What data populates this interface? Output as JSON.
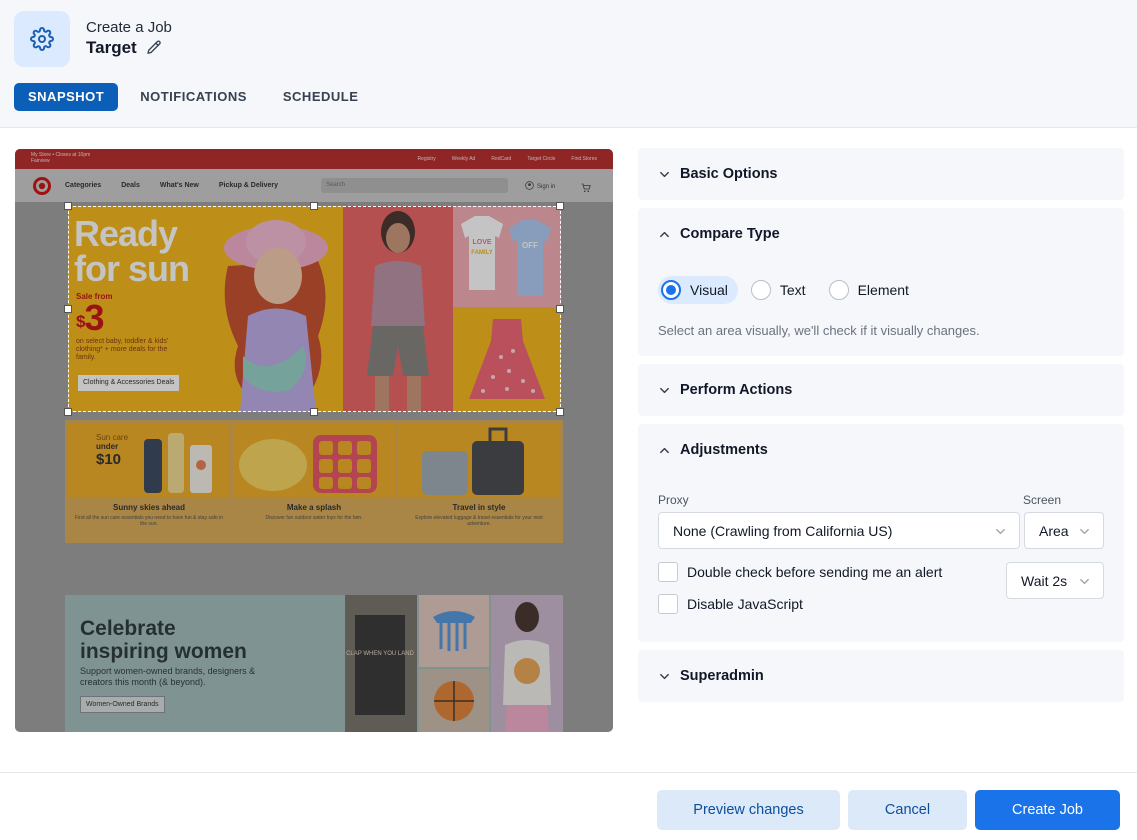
{
  "header": {
    "breadcrumb": "Create a Job",
    "title": "Target",
    "tabs": [
      {
        "label": "SNAPSHOT",
        "active": true
      },
      {
        "label": "NOTIFICATIONS",
        "active": false
      },
      {
        "label": "SCHEDULE",
        "active": false
      }
    ]
  },
  "preview": {
    "topbar": {
      "location": "My Store  •  Closes at 10pm",
      "store": "Fairview",
      "links": [
        "Registry",
        "Weekly Ad",
        "RedCard",
        "Target Circle",
        "Find Stores"
      ]
    },
    "nav": {
      "links": [
        "Categories",
        "Deals",
        "What's New",
        "Pickup & Delivery"
      ],
      "search_placeholder": "Search",
      "signin": "Sign in"
    },
    "hero": {
      "headline_1": "Ready",
      "headline_2": "for sun",
      "sale_from": "Sale from",
      "price": "3",
      "currency": "$",
      "description": "on select baby, toddler & kids' clothing* + more deals for the family.",
      "button": "Clothing & Accessories Deals",
      "onesie_text_1": "LOVE",
      "onesie_text_2": "FAMILY",
      "onesie_text_3": "OFF"
    },
    "cards": [
      {
        "title": "Sunny skies ahead",
        "subtitle": "Find all the sun care essentials you need to have fun & stay safe in the sun.",
        "badge_1": "Sun care",
        "badge_2": "under",
        "badge_3": "$10"
      },
      {
        "title": "Make a splash",
        "subtitle": "Discover fun outdoor water toys for the fam."
      },
      {
        "title": "Travel in style",
        "subtitle": "Explore elevated luggage & travel essentials for your next adventure."
      }
    ],
    "banner2": {
      "title_1": "Celebrate",
      "title_2": "inspiring women",
      "subtitle": "Support women-owned brands, designers & creators this month (& beyond).",
      "button": "Women-Owned Brands",
      "book_text": "CLAP WHEN YOU LAND"
    }
  },
  "sections": {
    "basic_options": {
      "label": "Basic Options",
      "expanded": false
    },
    "compare_type": {
      "label": "Compare Type",
      "expanded": true,
      "options": [
        {
          "label": "Visual",
          "selected": true
        },
        {
          "label": "Text",
          "selected": false
        },
        {
          "label": "Element",
          "selected": false
        }
      ],
      "hint": "Select an area visually, we'll check if it visually changes."
    },
    "perform_actions": {
      "label": "Perform Actions",
      "expanded": false
    },
    "adjustments": {
      "label": "Adjustments",
      "expanded": true,
      "proxy_label": "Proxy",
      "proxy_value": "None (Crawling from California US)",
      "screen_label": "Screen",
      "screen_value": "Area",
      "double_check_label": "Double check before sending me an alert",
      "double_check_checked": false,
      "wait_value": "Wait 2s",
      "disable_js_label": "Disable JavaScript",
      "disable_js_checked": false
    },
    "superadmin": {
      "label": "Superadmin",
      "expanded": false
    }
  },
  "footer": {
    "preview_label": "Preview changes",
    "cancel_label": "Cancel",
    "create_label": "Create Job"
  },
  "colors": {
    "accent": "#1a73e8",
    "tab_active": "#0b5fb8",
    "panel_bg": "#f5f7fa",
    "target_red": "#cc0000"
  },
  "icons": {
    "app": "gear-icon",
    "title_edit": "pencil-icon",
    "collapsed": "chevron-down-icon",
    "expanded": "chevron-up-icon"
  }
}
